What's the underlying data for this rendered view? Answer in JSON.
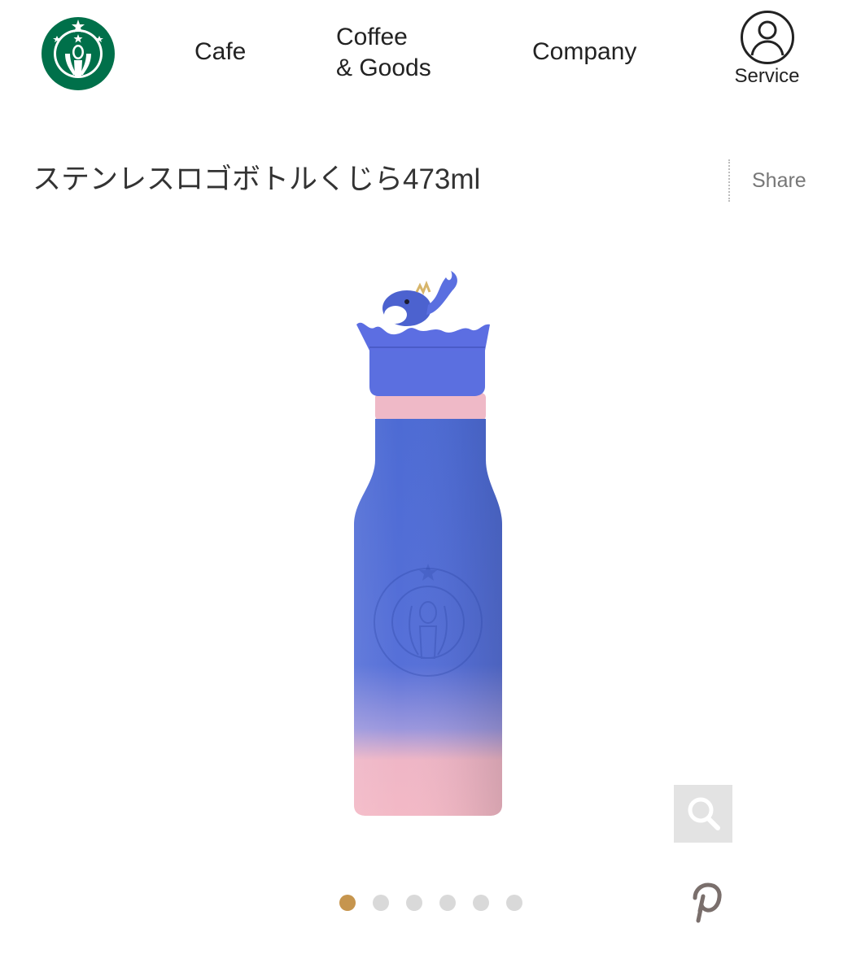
{
  "header": {
    "logo_alt": "Starbucks",
    "nav": {
      "cafe": "Cafe",
      "goods_line1": "Coffee",
      "goods_line2": "& Goods",
      "company": "Company"
    },
    "service_label": "Service"
  },
  "product": {
    "title": "ステンレスロゴボトルくじら473ml",
    "share_label": "Share",
    "image_alt": "ステンレスロゴボトルくじら473ml",
    "zoom_icon": "magnifier-icon",
    "pinterest_icon": "pinterest-icon"
  },
  "carousel": {
    "dot_count": 6,
    "active_index": 0
  },
  "colors": {
    "brand_green": "#00704A",
    "dot_active": "#c6954e",
    "dot_inactive": "#d9d9d9",
    "bottle_blue": "#4f6fd6",
    "bottle_pink": "#f2b8c4"
  }
}
